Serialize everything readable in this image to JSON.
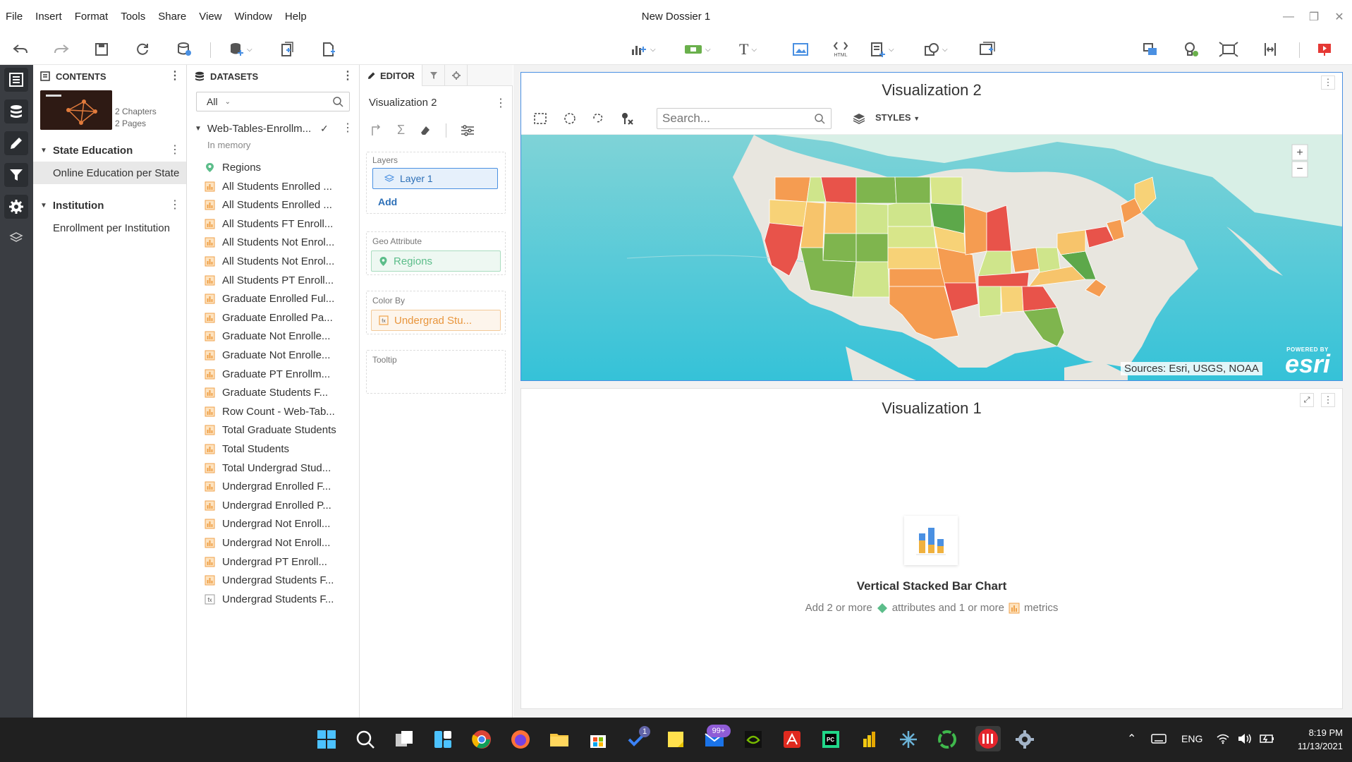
{
  "menu": [
    "File",
    "Insert",
    "Format",
    "Tools",
    "Share",
    "View",
    "Window",
    "Help"
  ],
  "document_title": "New Dossier 1",
  "contents_panel": {
    "header": "CONTENTS",
    "meta_chapters": "2 Chapters",
    "meta_pages": "2 Pages",
    "chapters": [
      {
        "title": "State Education",
        "pages": [
          "Online Education per State"
        ]
      },
      {
        "title": "Institution",
        "pages": [
          "Enrollment per Institution"
        ]
      }
    ]
  },
  "datasets_panel": {
    "header": "DATASETS",
    "filter_value": "All",
    "dataset_name": "Web-Tables-Enrollm...",
    "dataset_status": "In memory",
    "attribute": "Regions",
    "metrics": [
      "All Students Enrolled ...",
      "All Students Enrolled ...",
      "All Students FT Enroll...",
      "All Students Not Enrol...",
      "All Students Not Enrol...",
      "All Students PT Enroll...",
      "Graduate Enrolled Ful...",
      "Graduate Enrolled Pa...",
      "Graduate Not Enrolle...",
      "Graduate Not Enrolle...",
      "Graduate PT Enrollm...",
      "Graduate Students F...",
      "Row Count - Web-Tab...",
      "Total Graduate Students",
      "Total Students",
      "Total Undergrad Stud...",
      "Undergrad Enrolled F...",
      "Undergrad Enrolled P...",
      "Undergrad Not Enroll...",
      "Undergrad Not Enroll...",
      "Undergrad PT Enroll...",
      "Undergrad Students F...",
      "Undergrad Students F..."
    ]
  },
  "editor_panel": {
    "tab_editor": "EDITOR",
    "viz_name": "Visualization 2",
    "layers_label": "Layers",
    "layer_item": "Layer 1",
    "add_label": "Add",
    "geo_label": "Geo Attribute",
    "geo_value": "Regions",
    "color_label": "Color By",
    "color_value": "Undergrad Stu...",
    "tooltip_label": "Tooltip"
  },
  "viz2": {
    "title": "Visualization 2",
    "search_placeholder": "Search...",
    "styles_label": "STYLES",
    "zoom_in": "+",
    "zoom_out": "−",
    "attribution": "Sources: Esri, USGS, NOAA",
    "powered_by": "POWERED BY",
    "esri": "esri"
  },
  "viz1": {
    "title": "Visualization 1",
    "chart_type_label": "Vertical Stacked Bar Chart",
    "hint_part1": "Add 2 or more",
    "hint_part2": "attributes and 1 or more",
    "hint_part3": "metrics"
  },
  "taskbar": {
    "language": "ENG",
    "time": "8:19 PM",
    "date": "11/13/2021",
    "badge_teams": "1",
    "badge_mail": "99+"
  },
  "colors": {
    "accent": "#4a90e2",
    "metric_orange": "#f0a24a",
    "attribute_green": "#5cbd8a",
    "rail_bg": "#3a3d42"
  }
}
